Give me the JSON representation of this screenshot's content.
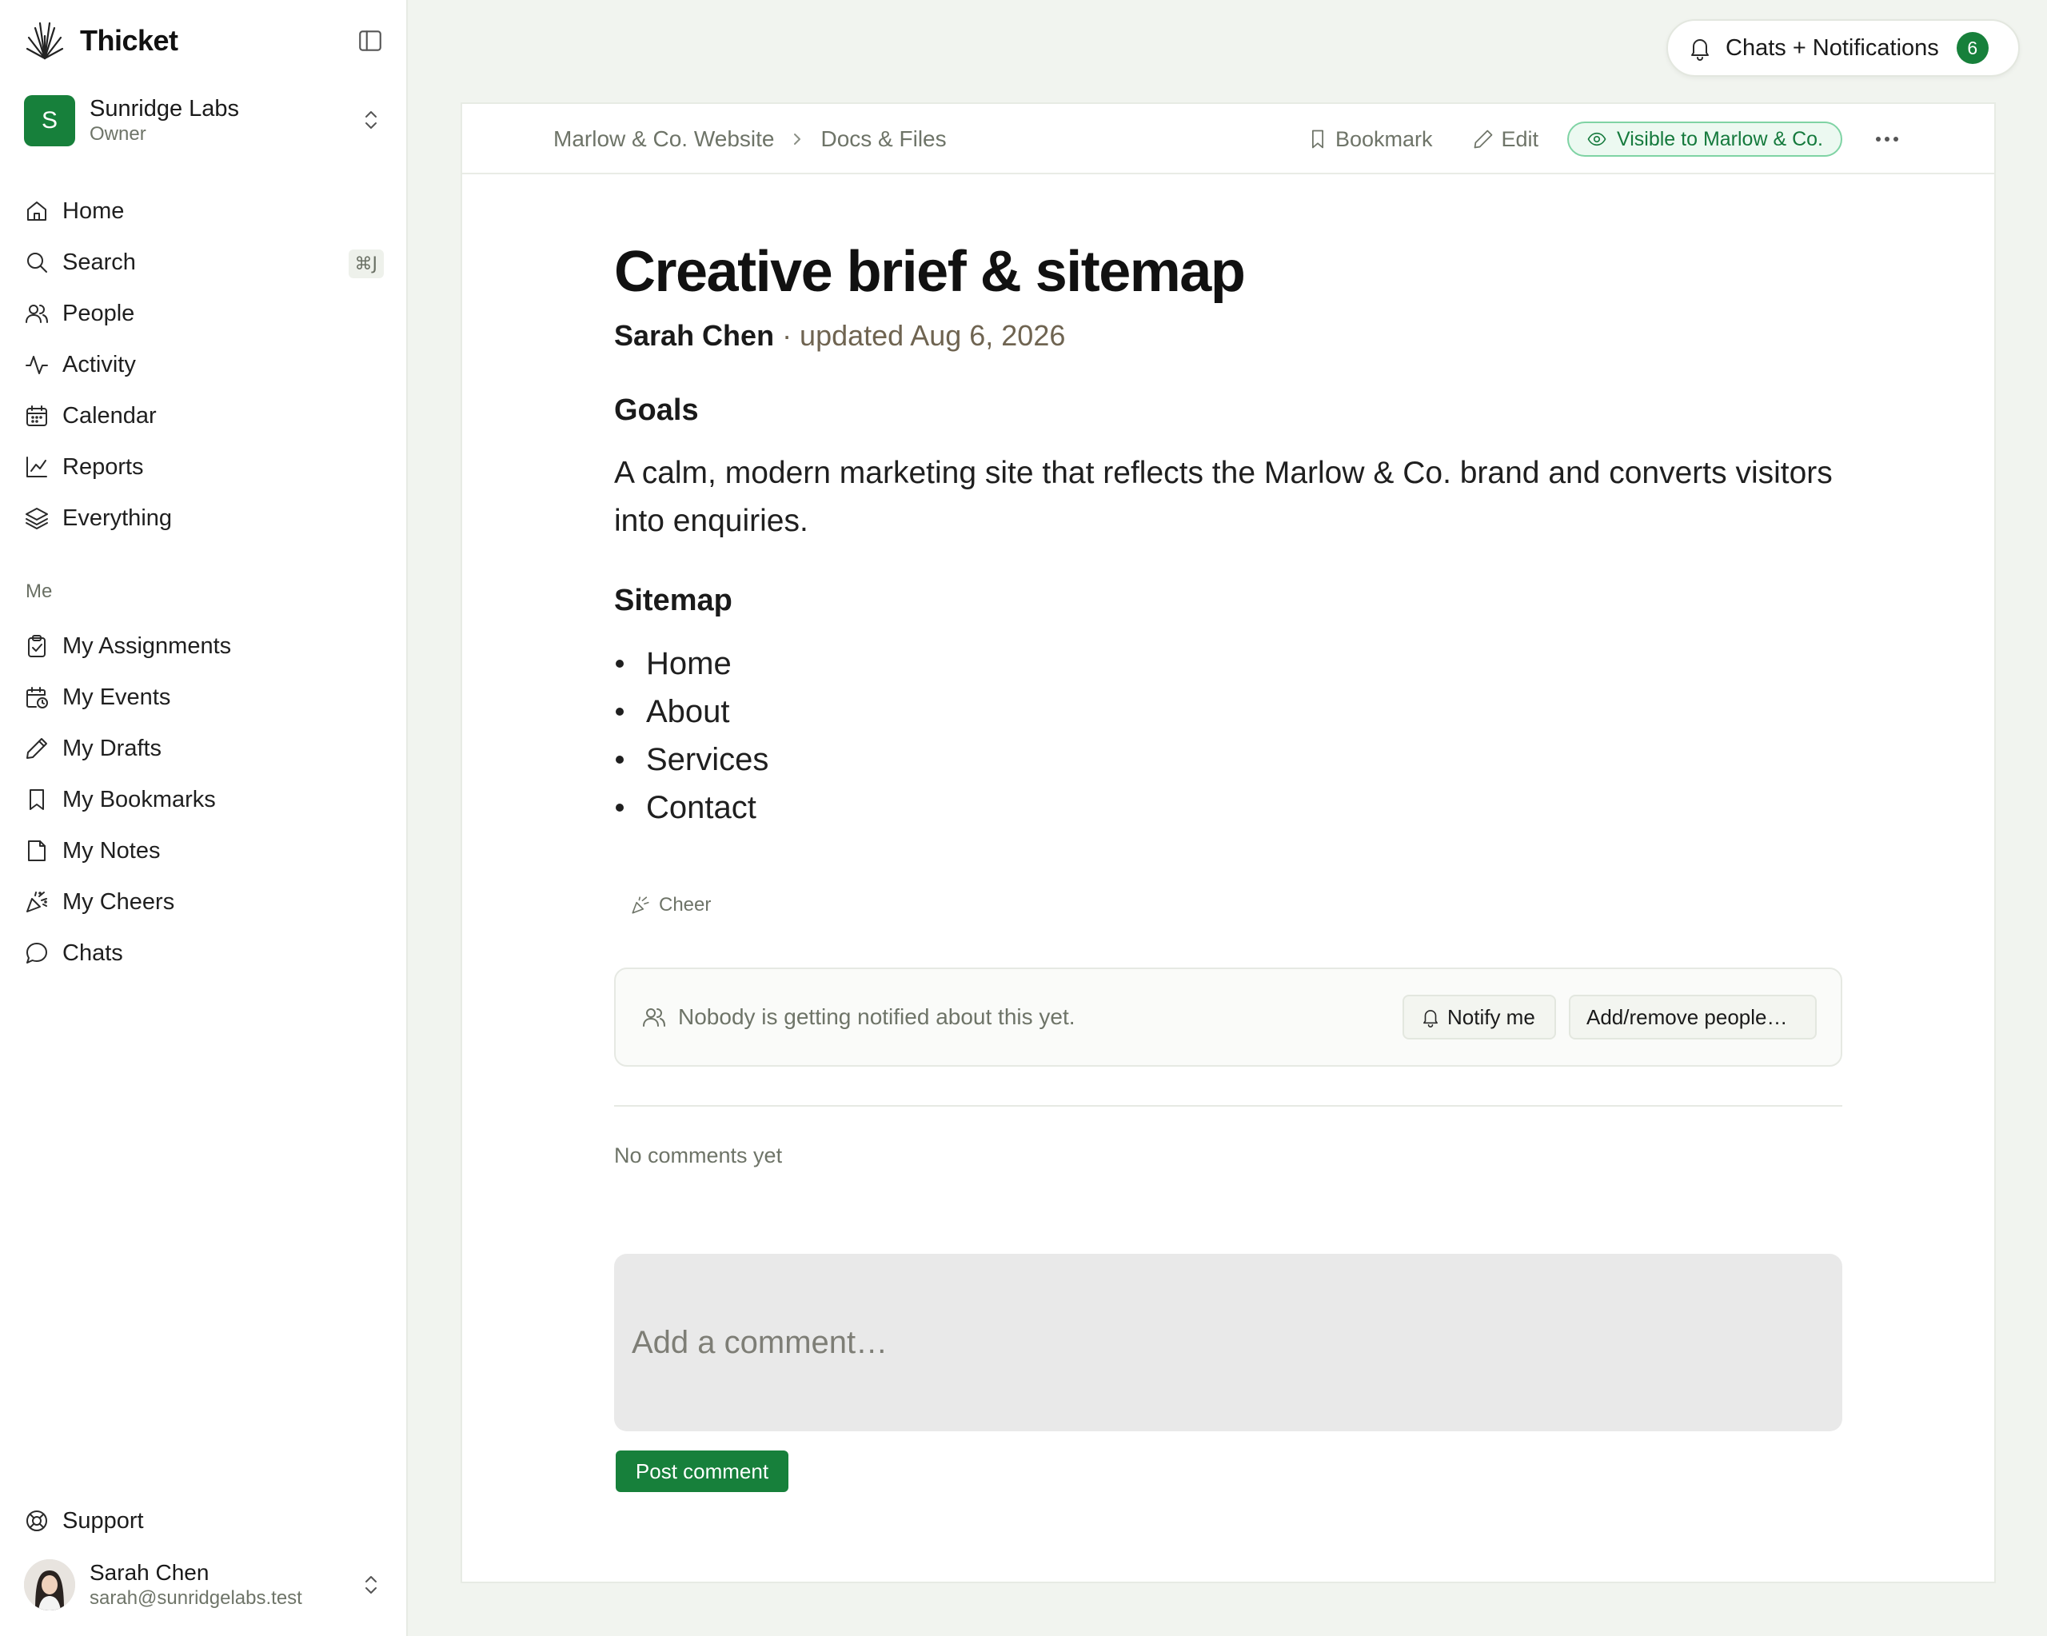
{
  "app": {
    "name": "Thicket"
  },
  "workspace": {
    "initial": "S",
    "name": "Sunridge Labs",
    "role": "Owner"
  },
  "nav": [
    {
      "id": "home",
      "label": "Home"
    },
    {
      "id": "search",
      "label": "Search",
      "shortcut": "⌘J"
    },
    {
      "id": "people",
      "label": "People"
    },
    {
      "id": "activity",
      "label": "Activity"
    },
    {
      "id": "calendar",
      "label": "Calendar"
    },
    {
      "id": "reports",
      "label": "Reports"
    },
    {
      "id": "everything",
      "label": "Everything"
    }
  ],
  "me_section": {
    "label": "Me",
    "items": [
      {
        "id": "my-assignments",
        "label": "My Assignments"
      },
      {
        "id": "my-events",
        "label": "My Events"
      },
      {
        "id": "my-drafts",
        "label": "My Drafts"
      },
      {
        "id": "my-bookmarks",
        "label": "My Bookmarks"
      },
      {
        "id": "my-notes",
        "label": "My Notes"
      },
      {
        "id": "my-cheers",
        "label": "My Cheers"
      },
      {
        "id": "chats",
        "label": "Chats"
      }
    ]
  },
  "support": {
    "label": "Support"
  },
  "user": {
    "name": "Sarah Chen",
    "email": "sarah@sunridgelabs.test"
  },
  "notifications": {
    "label": "Chats + Notifications",
    "count": "6"
  },
  "breadcrumb": [
    "Marlow & Co. Website",
    "Docs & Files"
  ],
  "toolbar": {
    "bookmark": "Bookmark",
    "edit": "Edit",
    "visibility": "Visible to Marlow & Co."
  },
  "doc": {
    "title": "Creative brief & sitemap",
    "author": "Sarah Chen",
    "updated": " · updated Aug 6, 2026",
    "sections": [
      {
        "heading": "Goals",
        "body": "A calm, modern marketing site that reflects the Marlow & Co. brand and converts visitors into enquiries."
      },
      {
        "heading": "Sitemap",
        "items": [
          "Home",
          "About",
          "Services",
          "Contact"
        ]
      }
    ]
  },
  "cheer": {
    "label": "Cheer"
  },
  "notify": {
    "message": "Nobody is getting notified about this yet.",
    "notify_me": "Notify me",
    "add_remove": "Add/remove people…"
  },
  "comments": {
    "empty": "No comments yet",
    "placeholder": "Add a comment…",
    "post": "Post comment"
  },
  "colors": {
    "accent": "#17803b",
    "visible_border": "#7fd3a4",
    "page_bg": "#f1f4ef"
  }
}
